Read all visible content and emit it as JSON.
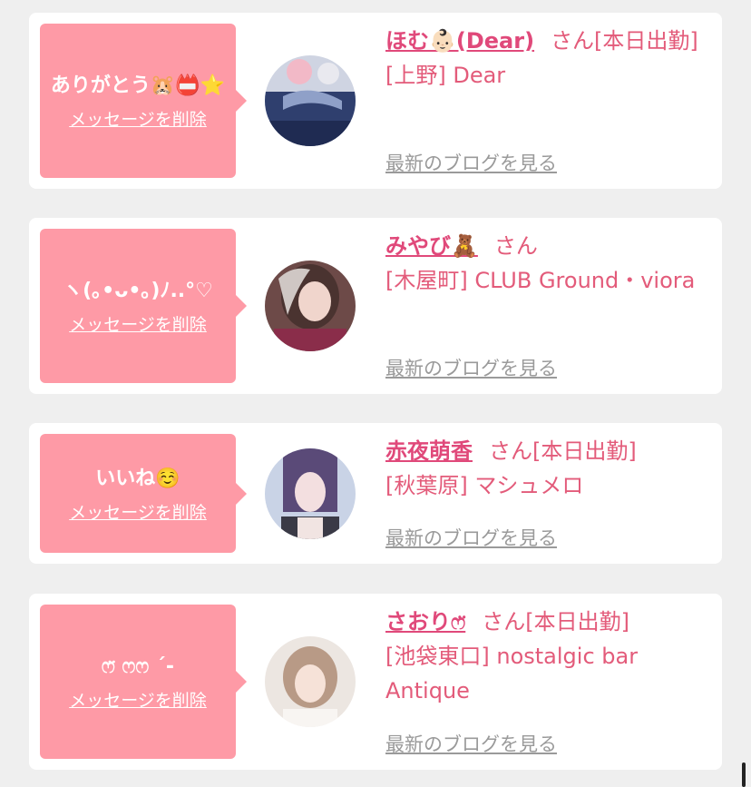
{
  "items": [
    {
      "message": "ありがとう🐹📛⭐️",
      "delete_label": "メッセージを削除",
      "name": "ほむ👶🏻(Dear)",
      "suffix": "さん[本日出勤]",
      "shop": "[上野] Dear",
      "blog_link": "最新のブログを見る"
    },
    {
      "message": "ヽ(｡•ᴗ•｡)ﾉ..°♡",
      "delete_label": "メッセージを削除",
      "name": "みやび🧸",
      "suffix": "さん",
      "shop": "[木屋町] CLUB Ground・viora",
      "blog_link": "最新のブログを見る"
    },
    {
      "message": "いいね☺️",
      "delete_label": "メッセージを削除",
      "name": "赤夜萌香",
      "suffix": "さん[本日出勤]",
      "shop": "[秋葉原] マシュメロ",
      "blog_link": "最新のブログを見る"
    },
    {
      "message": "ෆ̈ ෆෆ ˊ-",
      "delete_label": "メッセージを削除",
      "name": "さおりෆ̈",
      "suffix": "さん[本日出勤]",
      "shop": "[池袋東口] nostalgic bar Antique",
      "blog_link": "最新のブログを見る"
    }
  ]
}
